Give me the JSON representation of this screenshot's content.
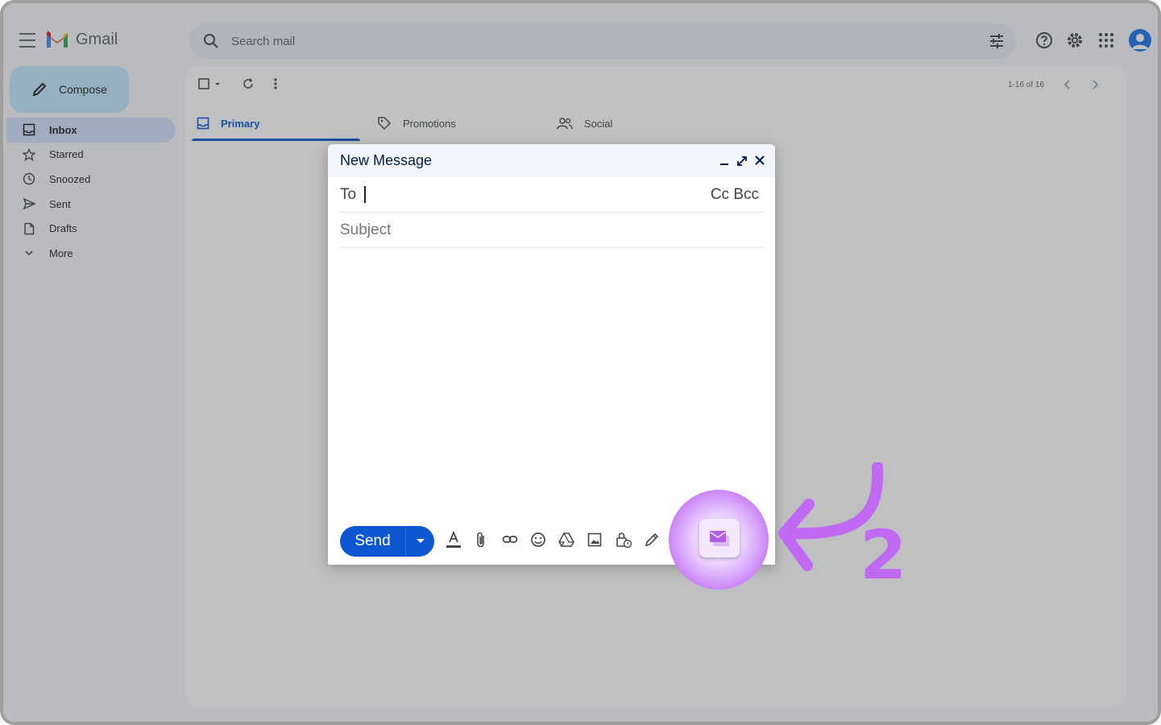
{
  "app": {
    "name": "Gmail"
  },
  "search": {
    "placeholder": "Search mail"
  },
  "sidebar": {
    "compose_label": "Compose",
    "items": [
      {
        "label": "Inbox",
        "icon": "inbox-icon",
        "active": true
      },
      {
        "label": "Starred",
        "icon": "star-icon",
        "active": false
      },
      {
        "label": "Snoozed",
        "icon": "clock-icon",
        "active": false
      },
      {
        "label": "Sent",
        "icon": "send-icon",
        "active": false
      },
      {
        "label": "Drafts",
        "icon": "draft-icon",
        "active": false
      },
      {
        "label": "More",
        "icon": "chevron-down-icon",
        "active": false
      }
    ]
  },
  "toolbar": {
    "pager": "1-16 of 16"
  },
  "tabs": [
    {
      "label": "Primary",
      "icon": "inbox-icon",
      "active": true
    },
    {
      "label": "Promotions",
      "icon": "tag-icon",
      "active": false
    },
    {
      "label": "Social",
      "icon": "people-icon",
      "active": false
    }
  ],
  "compose_dialog": {
    "title": "New Message",
    "to_label": "To",
    "cc_bcc": "Cc Bcc",
    "subject_placeholder": "Subject",
    "send_label": "Send"
  },
  "annotation": {
    "step": "2"
  },
  "colors": {
    "accent": "#0b57d0",
    "compose_bg": "#c2e7ff",
    "highlight": "#c77bf5",
    "annotation": "#c069f2"
  }
}
